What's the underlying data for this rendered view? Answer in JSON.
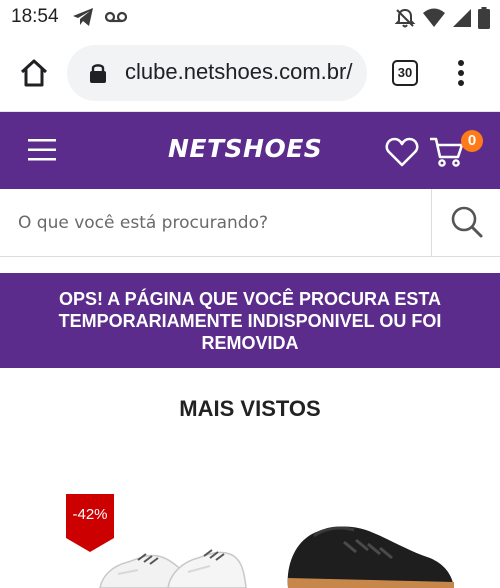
{
  "status_bar": {
    "time": "18:54",
    "left_icons": [
      "telegram-icon",
      "voicemail-icon"
    ],
    "right_icons": [
      "notifications-off-icon",
      "wifi-icon",
      "signal-icon",
      "battery-icon"
    ]
  },
  "browser": {
    "url": "clube.netshoes.com.br/",
    "tab_count": "30"
  },
  "site_header": {
    "logo": "NETSHOES",
    "cart_count": "0",
    "brand_color": "#5b2c8c",
    "badge_color": "#ff7b1a"
  },
  "search": {
    "placeholder": "O que você está procurando?"
  },
  "banner": {
    "message": "OPS! A PÁGINA QUE VOCÊ PROCURA ESTA TEMPORARIAMENTE INDISPONIVEL OU FOI REMOVIDA"
  },
  "most_viewed": {
    "title": "MAIS VISTOS",
    "products": [
      {
        "discount": "-42%",
        "image": "white-sneaker"
      },
      {
        "discount": "",
        "image": "black-sneaker"
      }
    ]
  }
}
